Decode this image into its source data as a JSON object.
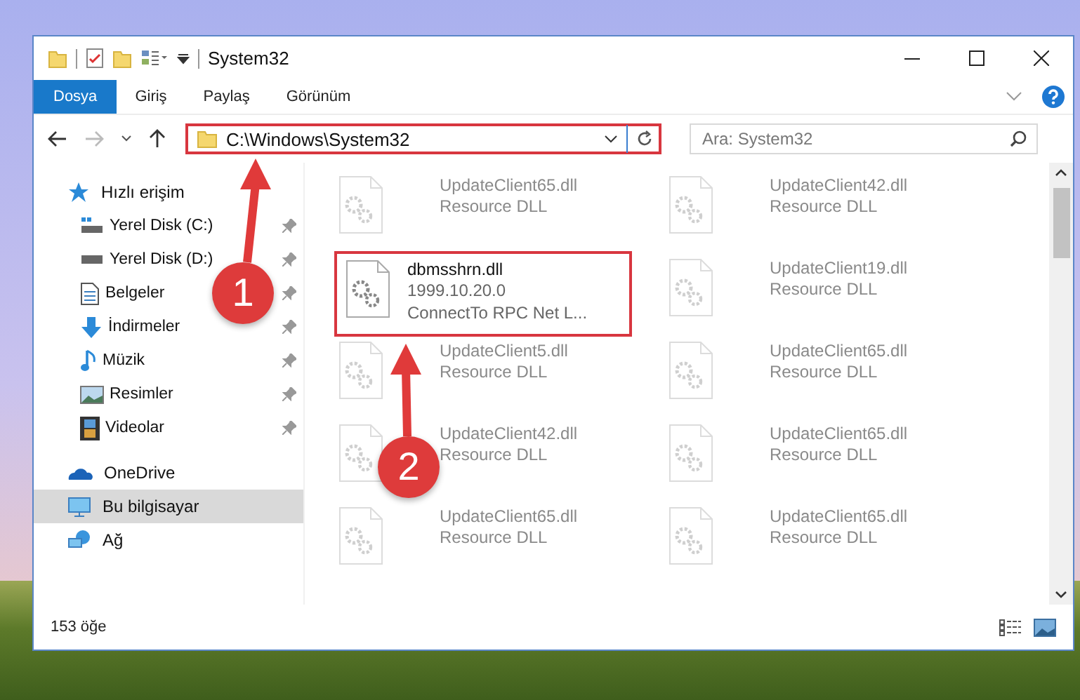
{
  "window": {
    "title": "System32"
  },
  "ribbon": {
    "tabs": [
      {
        "label": "Dosya",
        "selected": true
      },
      {
        "label": "Giriş",
        "selected": false
      },
      {
        "label": "Paylaş",
        "selected": false
      },
      {
        "label": "Görünüm",
        "selected": false
      }
    ]
  },
  "address_bar": {
    "path": "C:\\Windows\\System32",
    "highlighted": true
  },
  "search": {
    "placeholder": "Ara: System32"
  },
  "sidebar": {
    "items": [
      {
        "label": "Hızlı erişim",
        "kind": "quick",
        "selected": false,
        "children": [
          {
            "label": "Yerel Disk (C:)",
            "kind": "drive-c",
            "pinned": true,
            "selected": false
          },
          {
            "label": "Yerel Disk (D:)",
            "kind": "drive",
            "pinned": true,
            "selected": false
          },
          {
            "label": "Belgeler",
            "kind": "docs",
            "pinned": true,
            "selected": false
          },
          {
            "label": "İndirmeler",
            "kind": "download",
            "pinned": true,
            "selected": false
          },
          {
            "label": "Müzik",
            "kind": "music",
            "pinned": true,
            "selected": false
          },
          {
            "label": "Resimler",
            "kind": "pictures",
            "pinned": true,
            "selected": false
          },
          {
            "label": "Videolar",
            "kind": "video",
            "pinned": true,
            "selected": false
          }
        ]
      },
      {
        "label": "OneDrive",
        "kind": "cloud",
        "selected": false
      },
      {
        "label": "Bu bilgisayar",
        "kind": "pc",
        "selected": true
      },
      {
        "label": "Ağ",
        "kind": "network",
        "selected": false
      }
    ]
  },
  "files": [
    {
      "name": "UpdateClient65.dll",
      "lines": [
        "Resource DLL"
      ],
      "dimmed": true,
      "highlighted": false
    },
    {
      "name": "UpdateClient42.dll",
      "lines": [
        "Resource DLL"
      ],
      "dimmed": true,
      "highlighted": false
    },
    {
      "name": "dbmsshrn.dll",
      "lines": [
        "1999.10.20.0",
        "ConnectTo RPC Net L..."
      ],
      "dimmed": false,
      "highlighted": true
    },
    {
      "name": "UpdateClient19.dll",
      "lines": [
        "Resource DLL"
      ],
      "dimmed": true,
      "highlighted": false
    },
    {
      "name": "UpdateClient5.dll",
      "lines": [
        "Resource DLL"
      ],
      "dimmed": true,
      "highlighted": false
    },
    {
      "name": "UpdateClient65.dll",
      "lines": [
        "Resource DLL"
      ],
      "dimmed": true,
      "highlighted": false
    },
    {
      "name": "UpdateClient42.dll",
      "lines": [
        "Resource DLL"
      ],
      "dimmed": true,
      "highlighted": false
    },
    {
      "name": "UpdateClient65.dll",
      "lines": [
        "Resource DLL"
      ],
      "dimmed": true,
      "highlighted": false
    },
    {
      "name": "UpdateClient65.dll",
      "lines": [
        "Resource DLL"
      ],
      "dimmed": true,
      "highlighted": false
    },
    {
      "name": "UpdateClient65.dll",
      "lines": [
        "Resource DLL"
      ],
      "dimmed": true,
      "highlighted": false
    }
  ],
  "annotations": [
    {
      "number": "1"
    },
    {
      "number": "2"
    }
  ],
  "status_bar": {
    "item_count": "153 öğe"
  }
}
